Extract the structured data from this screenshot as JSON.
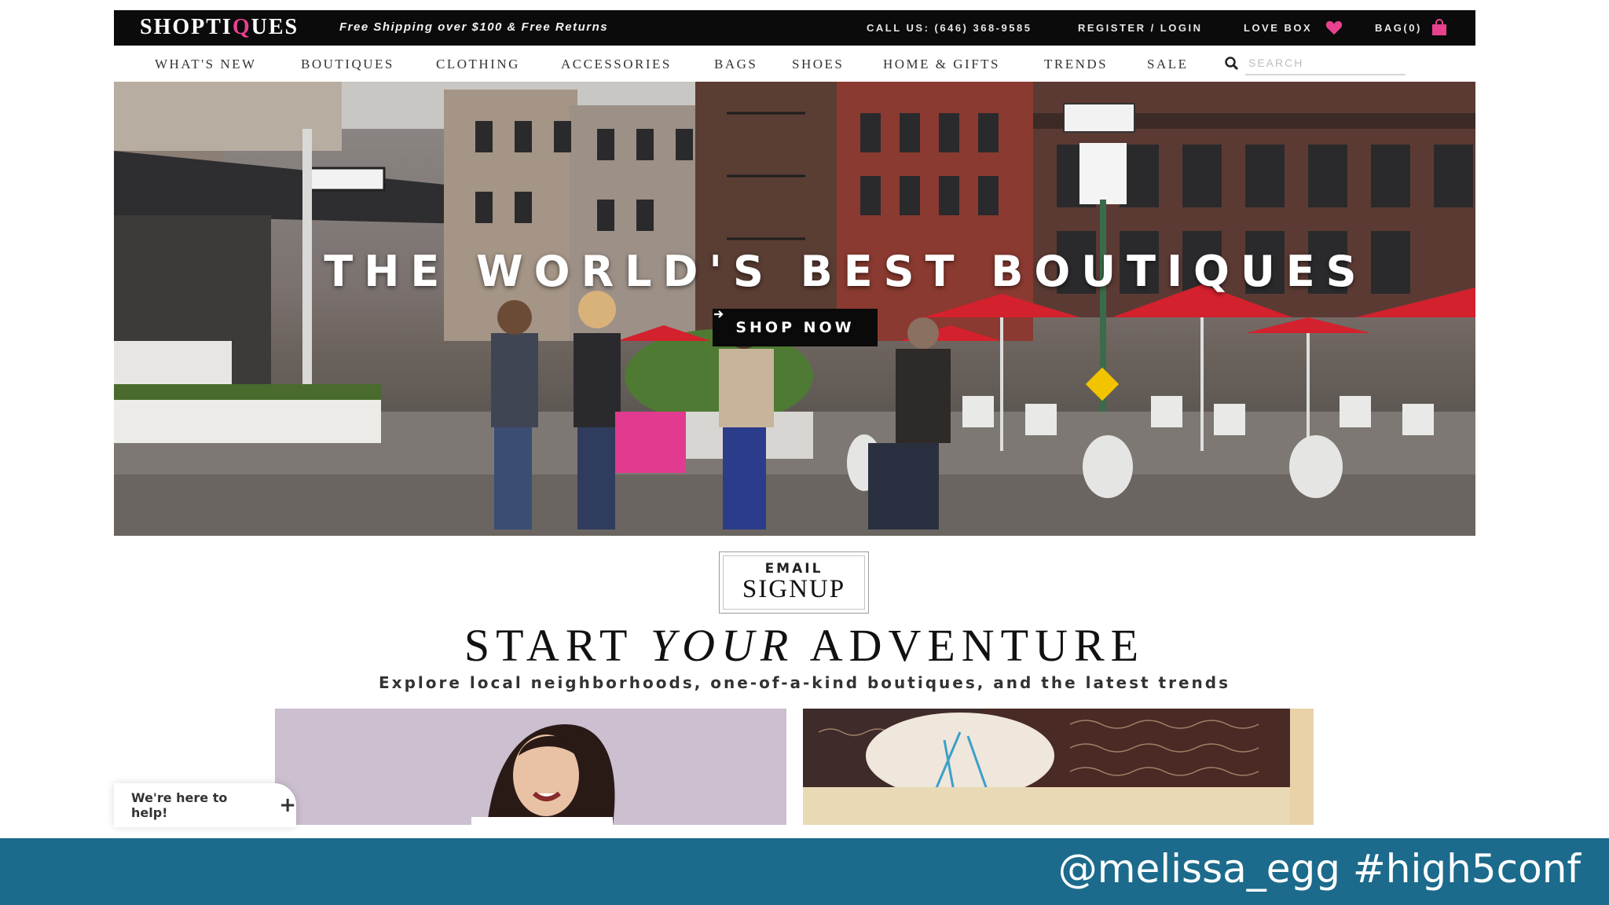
{
  "topbar": {
    "logo_pre": "SHOPTI",
    "logo_accent": "Q",
    "logo_post": "UES",
    "promo": "Free Shipping over $100 & Free Returns",
    "call": "CALL US: (646) 368-9585",
    "register": "REGISTER / LOGIN",
    "lovebox": "LOVE BOX",
    "bag": "BAG(0)"
  },
  "nav": {
    "items": [
      "WHAT'S NEW",
      "BOUTIQUES",
      "CLOTHING",
      "ACCESSORIES",
      "BAGS",
      "SHOES",
      "HOME & GIFTS",
      "TRENDS",
      "SALE"
    ],
    "search_placeholder": "SEARCH"
  },
  "hero": {
    "title": "THE WORLD'S BEST BOUTIQUES",
    "button": "SHOP NOW",
    "button_icon": "arrow-right-icon"
  },
  "signup": {
    "small": "EMAIL",
    "big": "SIGNUP"
  },
  "adventure": {
    "pre": "START",
    "italic": "YOUR",
    "post": "ADVENTURE",
    "subtitle": "Explore local neighborhoods, one-of-a-kind boutiques, and the latest trends"
  },
  "help": {
    "label": "We're here to help!",
    "icon": "plus-icon"
  },
  "footer": {
    "handle": "@melissa_egg #high5conf"
  },
  "colors": {
    "brand_pink": "#e8418f",
    "footer_teal": "#1c6b8c",
    "topbar_black": "#0b0b0b"
  }
}
